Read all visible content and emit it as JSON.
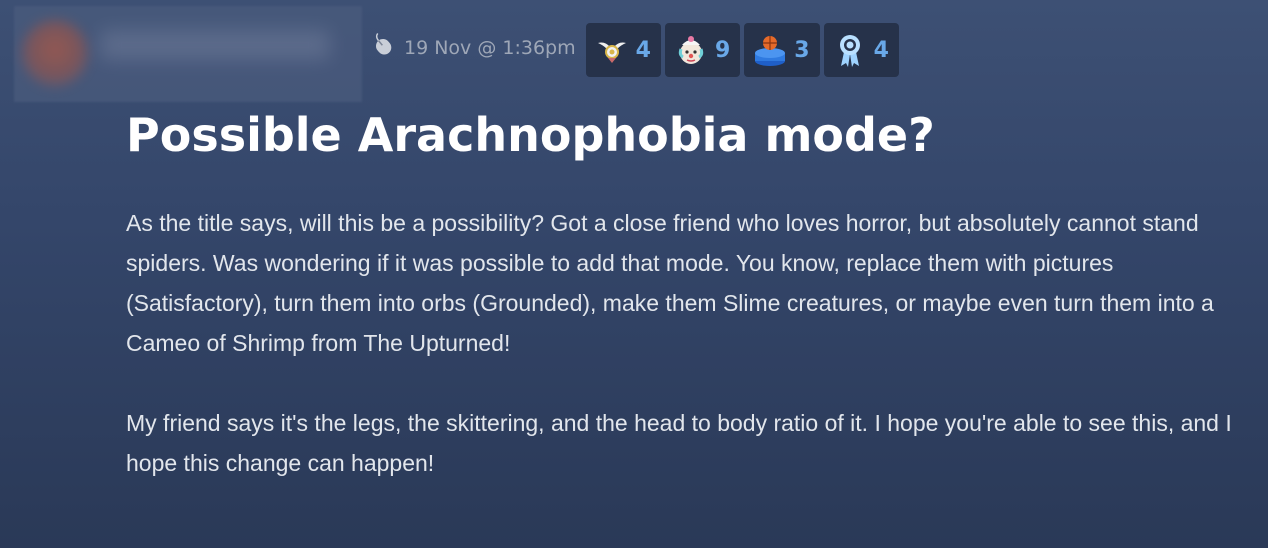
{
  "post": {
    "timestamp": "19 Nov @ 1:36pm",
    "title": "Possible Arachnophobia mode?",
    "paragraphs": [
      "As the title says, will this be a possibility? Got a close friend who loves horror, but absolutely cannot stand spiders. Was wondering if it was possible to add that mode. You know, replace them with pictures (Satisfactory), turn them into orbs (Grounded), make them Slime creatures, or maybe even turn them into a Cameo of Shrimp from The Upturned!",
      "My friend says it's the legs, the skittering, and the head to body ratio of it. I hope you're able to see this, and I hope this change can happen!"
    ]
  },
  "awards": [
    {
      "icon": "winged-award-icon",
      "count": "4"
    },
    {
      "icon": "clown-face-award-icon",
      "count": "9"
    },
    {
      "icon": "basketball-pedestal-award-icon",
      "count": "3"
    },
    {
      "icon": "ribbon-medal-award-icon",
      "count": "4"
    }
  ],
  "colors": {
    "award_count": "#69a8e8",
    "award_bg": "#26324a",
    "timestamp": "#9ea7b7"
  }
}
